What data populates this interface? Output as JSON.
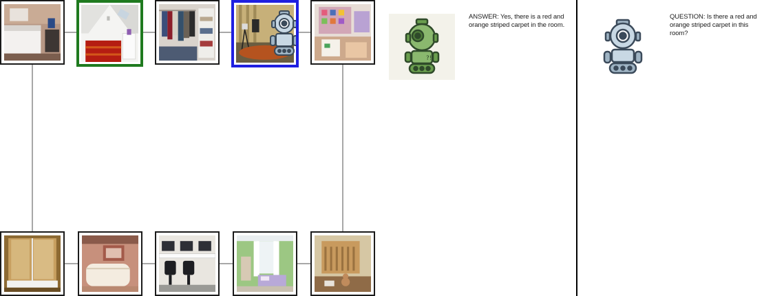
{
  "answer": {
    "text": "ANSWER: Yes, there is a red and orange striped carpet in the room."
  },
  "question": {
    "text": "QUESTION: Is there a red and orange striped carpet in this room?"
  },
  "colors": {
    "target_border": "#1f7a1f",
    "current_border": "#1f1fe0",
    "node_border": "#1a1a1a",
    "edge": "#8a8a8a",
    "answer_bot": "#6a9e4e",
    "question_bot": "#9fb4c4"
  },
  "graph": {
    "nodes": [
      {
        "id": "bedroom-hotel",
        "scene": "bedroom",
        "state": "normal"
      },
      {
        "id": "attic-red-carpet",
        "scene": "attic",
        "state": "target"
      },
      {
        "id": "closet",
        "scene": "closet",
        "state": "normal"
      },
      {
        "id": "studio",
        "scene": "studio",
        "state": "current",
        "agent": "robot-icon"
      },
      {
        "id": "kids-room",
        "scene": "kidsroom",
        "state": "normal"
      },
      {
        "id": "shower",
        "scene": "shower",
        "state": "normal"
      },
      {
        "id": "reception",
        "scene": "reception",
        "state": "normal"
      },
      {
        "id": "office",
        "scene": "office",
        "state": "normal"
      },
      {
        "id": "nursery-green",
        "scene": "nursery",
        "state": "normal"
      },
      {
        "id": "crib-room",
        "scene": "crib",
        "state": "normal"
      }
    ],
    "edges": [
      [
        "bedroom-hotel",
        "attic-red-carpet"
      ],
      [
        "attic-red-carpet",
        "closet"
      ],
      [
        "closet",
        "studio"
      ],
      [
        "studio",
        "kids-room"
      ],
      [
        "bedroom-hotel",
        "shower"
      ],
      [
        "kids-room",
        "crib-room"
      ],
      [
        "shower",
        "reception"
      ],
      [
        "reception",
        "office"
      ],
      [
        "office",
        "nursery-green"
      ],
      [
        "nursery-green",
        "crib-room"
      ]
    ]
  }
}
